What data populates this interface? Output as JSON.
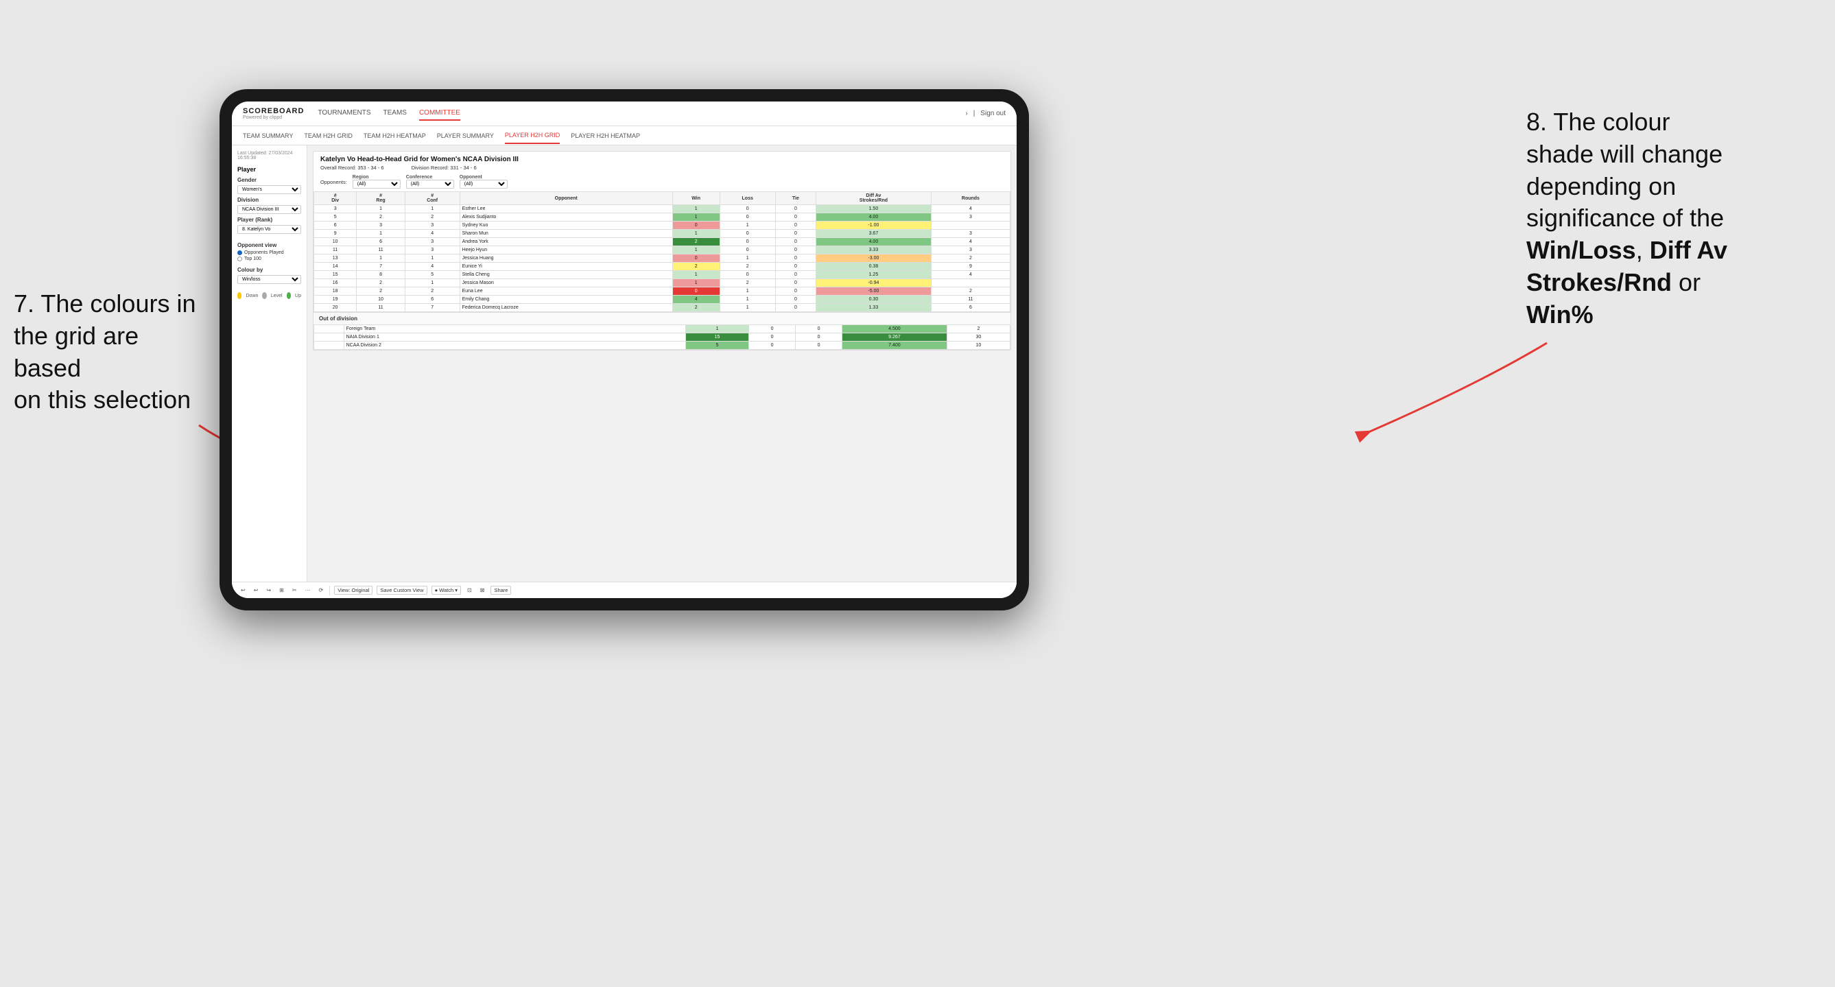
{
  "annotations": {
    "left": {
      "line1": "7. The colours in",
      "line2": "the grid are based",
      "line3": "on this selection"
    },
    "right": {
      "line1": "8. The colour",
      "line2": "shade will change",
      "line3": "depending on",
      "line4": "significance of the",
      "bold1": "Win/Loss",
      "comma1": ", ",
      "bold2": "Diff Av",
      "line5": "Strokes/Rnd",
      "line6": " or",
      "bold3": "Win%"
    }
  },
  "app": {
    "logo": "SCOREBOARD",
    "logo_sub": "Powered by clippd",
    "nav": [
      "TOURNAMENTS",
      "TEAMS",
      "COMMITTEE"
    ],
    "nav_active": "COMMITTEE",
    "header_right": "Sign out",
    "subnav": [
      "TEAM SUMMARY",
      "TEAM H2H GRID",
      "TEAM H2H HEATMAP",
      "PLAYER SUMMARY",
      "PLAYER H2H GRID",
      "PLAYER H2H HEATMAP"
    ],
    "subnav_active": "PLAYER H2H GRID"
  },
  "sidebar": {
    "last_updated_label": "Last Updated: 27/03/2024",
    "last_updated_time": "16:55:38",
    "player_section": "Player",
    "gender_label": "Gender",
    "gender_value": "Women's",
    "division_label": "Division",
    "division_value": "NCAA Division III",
    "player_rank_label": "Player (Rank)",
    "player_rank_value": "8. Katelyn Vo",
    "opponent_view_label": "Opponent view",
    "opponent_view_options": [
      "Opponents Played",
      "Top 100"
    ],
    "opponent_view_selected": "Opponents Played",
    "colour_by_label": "Colour by",
    "colour_by_value": "Win/loss",
    "legend": [
      {
        "color": "#f9c700",
        "label": "Down"
      },
      {
        "color": "#aaaaaa",
        "label": "Level"
      },
      {
        "color": "#4caf50",
        "label": "Up"
      }
    ]
  },
  "grid": {
    "title": "Katelyn Vo Head-to-Head Grid for Women's NCAA Division III",
    "overall_record_label": "Overall Record:",
    "overall_record_value": "353 - 34 - 6",
    "division_record_label": "Division Record:",
    "division_record_value": "331 - 34 - 6",
    "filter_opponents_label": "Opponents:",
    "filter_region_label": "Region",
    "filter_region_value": "(All)",
    "filter_conference_label": "Conference",
    "filter_conference_value": "(All)",
    "filter_opponent_label": "Opponent",
    "filter_opponent_value": "(All)",
    "table_headers": [
      "#\nDiv",
      "#\nReg",
      "#\nConf",
      "Opponent",
      "Win",
      "Loss",
      "Tie",
      "Diff Av\nStrokes/Rnd",
      "Rounds"
    ],
    "rows": [
      {
        "div": "3",
        "reg": "1",
        "conf": "1",
        "opponent": "Esther Lee",
        "win": 1,
        "loss": 0,
        "tie": 0,
        "diff": "1.50",
        "rounds": "4",
        "win_color": "green_light",
        "diff_color": "green_light"
      },
      {
        "div": "5",
        "reg": "2",
        "conf": "2",
        "opponent": "Alexis Sudjianto",
        "win": 1,
        "loss": 0,
        "tie": 0,
        "diff": "4.00",
        "rounds": "3",
        "win_color": "green_mid",
        "diff_color": "green_mid"
      },
      {
        "div": "6",
        "reg": "3",
        "conf": "3",
        "opponent": "Sydney Kuo",
        "win": 0,
        "loss": 1,
        "tie": 0,
        "diff": "-1.00",
        "rounds": "",
        "win_color": "red_light",
        "diff_color": "yellow"
      },
      {
        "div": "9",
        "reg": "1",
        "conf": "4",
        "opponent": "Sharon Mun",
        "win": 1,
        "loss": 0,
        "tie": 0,
        "diff": "3.67",
        "rounds": "3",
        "win_color": "green_light",
        "diff_color": "green_light"
      },
      {
        "div": "10",
        "reg": "6",
        "conf": "3",
        "opponent": "Andrea York",
        "win": 2,
        "loss": 0,
        "tie": 0,
        "diff": "4.00",
        "rounds": "4",
        "win_color": "green_dark",
        "diff_color": "green_mid"
      },
      {
        "div": "11",
        "reg": "11",
        "conf": "3",
        "opponent": "Heejo Hyun",
        "win": 1,
        "loss": 0,
        "tie": 0,
        "diff": "3.33",
        "rounds": "3",
        "win_color": "green_light",
        "diff_color": "green_light"
      },
      {
        "div": "13",
        "reg": "1",
        "conf": "1",
        "opponent": "Jessica Huang",
        "win": 0,
        "loss": 1,
        "tie": 0,
        "diff": "-3.00",
        "rounds": "2",
        "win_color": "red_light",
        "diff_color": "orange_light"
      },
      {
        "div": "14",
        "reg": "7",
        "conf": "4",
        "opponent": "Eunice Yi",
        "win": 2,
        "loss": 2,
        "tie": 0,
        "diff": "0.38",
        "rounds": "9",
        "win_color": "yellow",
        "diff_color": "green_light"
      },
      {
        "div": "15",
        "reg": "8",
        "conf": "5",
        "opponent": "Stella Cheng",
        "win": 1,
        "loss": 0,
        "tie": 0,
        "diff": "1.25",
        "rounds": "4",
        "win_color": "green_light",
        "diff_color": "green_light"
      },
      {
        "div": "16",
        "reg": "2",
        "conf": "1",
        "opponent": "Jessica Mason",
        "win": 1,
        "loss": 2,
        "tie": 0,
        "diff": "-0.94",
        "rounds": "",
        "win_color": "red_light",
        "diff_color": "yellow"
      },
      {
        "div": "18",
        "reg": "2",
        "conf": "2",
        "opponent": "Euna Lee",
        "win": 0,
        "loss": 1,
        "tie": 0,
        "diff": "-5.00",
        "rounds": "2",
        "win_color": "red_dark",
        "diff_color": "red_light"
      },
      {
        "div": "19",
        "reg": "10",
        "conf": "6",
        "opponent": "Emily Chang",
        "win": 4,
        "loss": 1,
        "tie": 0,
        "diff": "0.30",
        "rounds": "11",
        "win_color": "green_mid",
        "diff_color": "green_light"
      },
      {
        "div": "20",
        "reg": "11",
        "conf": "7",
        "opponent": "Federica Domecq Lacroze",
        "win": 2,
        "loss": 1,
        "tie": 0,
        "diff": "1.33",
        "rounds": "6",
        "win_color": "green_light",
        "diff_color": "green_light"
      }
    ],
    "out_of_division_label": "Out of division",
    "out_of_division_rows": [
      {
        "opponent": "Foreign Team",
        "win": 1,
        "loss": 0,
        "tie": 0,
        "diff": "4.500",
        "rounds": "2",
        "win_color": "green_light",
        "diff_color": "green_mid"
      },
      {
        "opponent": "NAIA Division 1",
        "win": 15,
        "loss": 0,
        "tie": 0,
        "diff": "9.267",
        "rounds": "30",
        "win_color": "green_dark",
        "diff_color": "green_dark"
      },
      {
        "opponent": "NCAA Division 2",
        "win": 5,
        "loss": 0,
        "tie": 0,
        "diff": "7.400",
        "rounds": "10",
        "win_color": "green_mid",
        "diff_color": "green_mid"
      }
    ]
  },
  "toolbar": {
    "buttons": [
      "↩",
      "↩",
      "↪",
      "⊞",
      "✂",
      "·",
      "⟳",
      "|",
      "View: Original",
      "Save Custom View",
      "Watch ▾",
      "⊡",
      "⊠",
      "Share"
    ]
  }
}
